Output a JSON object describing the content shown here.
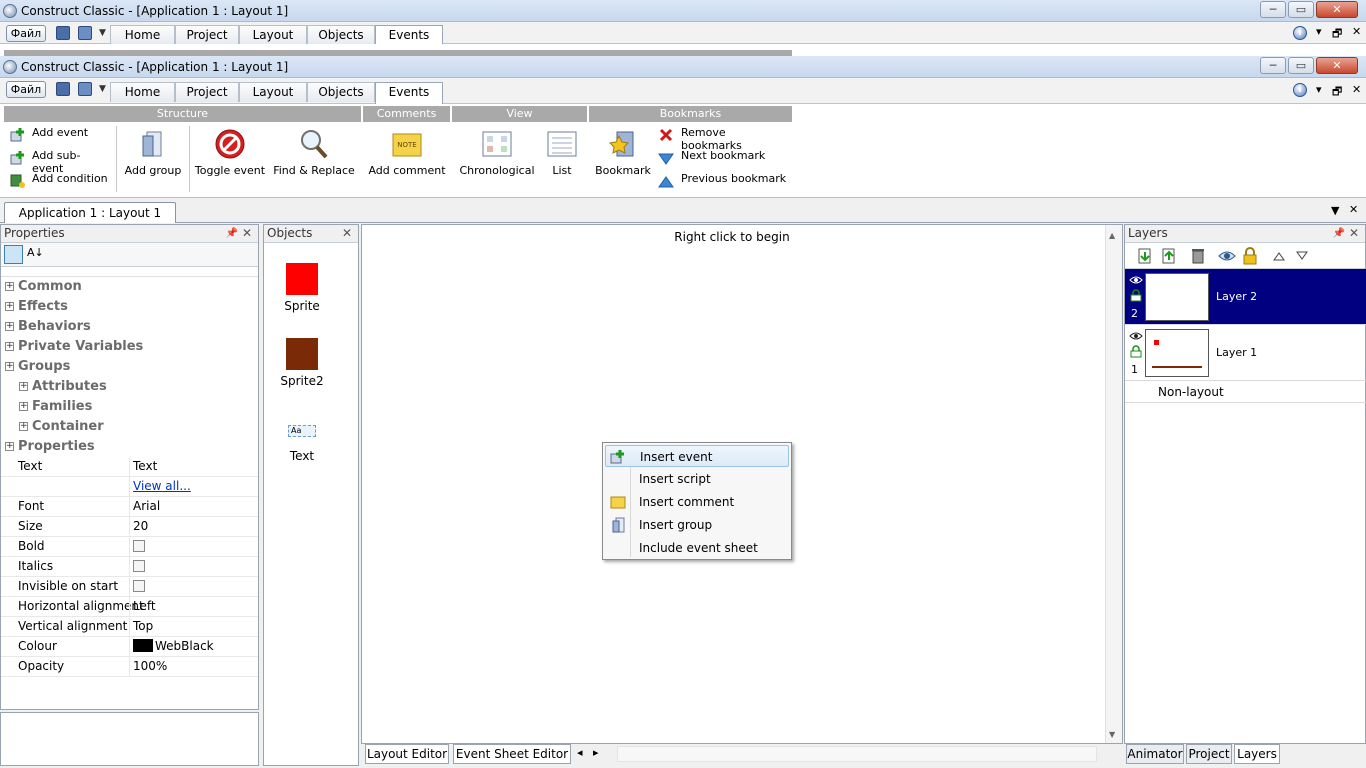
{
  "window": {
    "title": "Construct Classic - [Application 1 : Layout 1]",
    "file_label": "Файл",
    "ribbon_tabs": [
      "Home",
      "Project",
      "Layout",
      "Objects",
      "Events"
    ],
    "active_tab": "Events",
    "minimize": "─",
    "restore": "▭",
    "close": "✕",
    "help": "i",
    "mdi_pin": "▾",
    "mdi_restore": "🗗",
    "mdi_close": "✕"
  },
  "ribbon": {
    "groups": {
      "structure": "Structure",
      "comments": "Comments",
      "view": "View",
      "bookmarks": "Bookmarks"
    },
    "add_event": "Add event",
    "add_sub_event": "Add sub-event",
    "add_condition": "Add condition",
    "add_group": "Add group",
    "toggle_event": "Toggle event",
    "find_replace": "Find & Replace",
    "add_comment": "Add comment",
    "note_icon_text": "NOTE",
    "chronological": "Chronological",
    "list": "List",
    "bookmark": "Bookmark",
    "remove_bookmarks": "Remove bookmarks",
    "next_bookmark": "Next bookmark",
    "previous_bookmark": "Previous bookmark"
  },
  "doc_tab": "Application 1 : Layout 1",
  "properties": {
    "title": "Properties",
    "sort_icon_text": "A↓",
    "categories": [
      {
        "label": "Common",
        "sub": false
      },
      {
        "label": "Effects",
        "sub": false
      },
      {
        "label": "Behaviors",
        "sub": false
      },
      {
        "label": "Private Variables",
        "sub": false
      },
      {
        "label": "Groups",
        "sub": false
      },
      {
        "label": "Attributes",
        "sub": true
      },
      {
        "label": "Families",
        "sub": true
      },
      {
        "label": "Container",
        "sub": true
      },
      {
        "label": "Properties",
        "sub": false
      }
    ],
    "rows": [
      {
        "key": "Text",
        "value": "Text",
        "kind": "text"
      },
      {
        "key": "",
        "value": "View all...",
        "kind": "link"
      },
      {
        "key": "Font",
        "value": "Arial",
        "kind": "text"
      },
      {
        "key": "Size",
        "value": "20",
        "kind": "text"
      },
      {
        "key": "Bold",
        "value": "",
        "kind": "check"
      },
      {
        "key": "Italics",
        "value": "",
        "kind": "check"
      },
      {
        "key": "Invisible on start",
        "value": "",
        "kind": "check"
      },
      {
        "key": "Horizontal alignment",
        "value": "Left",
        "kind": "text"
      },
      {
        "key": "Vertical alignment",
        "value": "Top",
        "kind": "text"
      },
      {
        "key": "Colour",
        "value": "WebBlack",
        "kind": "color"
      },
      {
        "key": "Opacity",
        "value": "100%",
        "kind": "text"
      }
    ]
  },
  "objects": {
    "title": "Objects",
    "items": [
      {
        "label": "Sprite",
        "color": "#ff0000",
        "kind": "sprite"
      },
      {
        "label": "Sprite2",
        "color": "#7a2a06",
        "kind": "sprite"
      },
      {
        "label": "Text",
        "icon_text": "Aa",
        "kind": "text"
      }
    ]
  },
  "editor": {
    "hint": "Right click to begin",
    "bottom_tabs": [
      "Layout Editor",
      "Event Sheet Editor"
    ],
    "nav_left": "◂",
    "nav_right": "▸"
  },
  "context_menu": {
    "items": [
      "Insert event",
      "Insert script",
      "Insert comment",
      "Insert group",
      "Include event sheet"
    ],
    "highlighted": "Insert event"
  },
  "layers": {
    "title": "Layers",
    "items": [
      {
        "name": "Layer 2",
        "index": "2",
        "selected": true
      },
      {
        "name": "Layer 1",
        "index": "1",
        "selected": false
      }
    ],
    "non_layout": "Non-layout",
    "bottom_tabs": [
      "Animator",
      "Project",
      "Layers"
    ],
    "active_bottom_tab": "Layers"
  },
  "colors": {
    "selection": "#000080",
    "group_header": "#a9a9a9"
  }
}
